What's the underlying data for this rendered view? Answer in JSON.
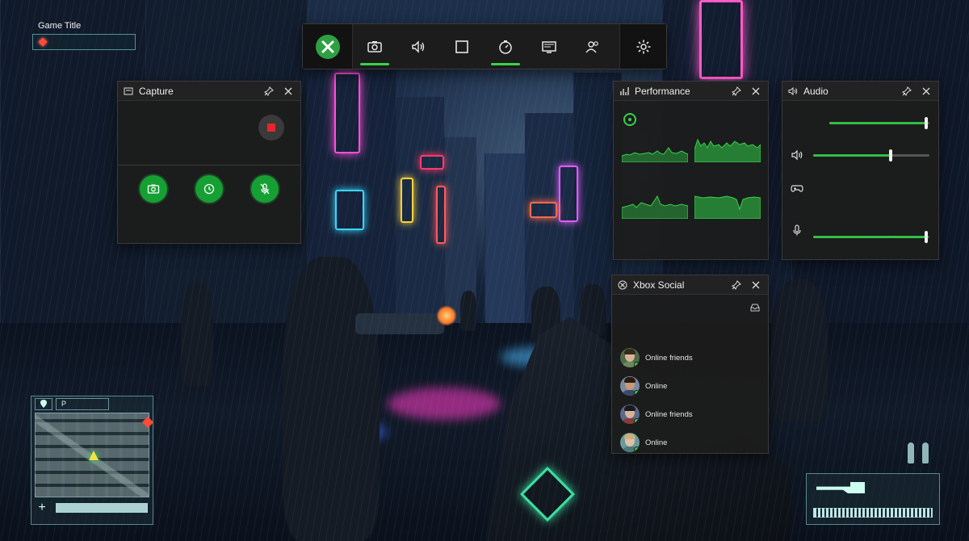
{
  "game_hud": {
    "title": "Game Title",
    "minimap_tabs": [
      "",
      "P"
    ]
  },
  "gamebar": {
    "buttons": [
      {
        "name": "capture",
        "icon": "camera-icon",
        "active": true
      },
      {
        "name": "audio",
        "icon": "speaker-icon",
        "active": false
      },
      {
        "name": "resources",
        "icon": "square-icon",
        "active": false
      },
      {
        "name": "performance",
        "icon": "gauge-icon",
        "active": true
      },
      {
        "name": "gallery",
        "icon": "monitor-icon",
        "active": false
      },
      {
        "name": "social",
        "icon": "people-icon",
        "active": false
      }
    ],
    "accent": "#3bd14a"
  },
  "capture": {
    "title": "Capture",
    "buttons": [
      "camera-icon",
      "record-last-icon",
      "mic-icon"
    ],
    "record_color": "#e8262a"
  },
  "performance": {
    "title": "Performance"
  },
  "audio": {
    "title": "Audio",
    "sliders": [
      {
        "icon": "",
        "level": 0.97
      },
      {
        "icon": "speaker-icon",
        "level": 0.67
      },
      {
        "icon": "gamepad-icon",
        "level": null
      },
      {
        "icon": "mic-icon",
        "level": 0.97
      }
    ]
  },
  "social": {
    "title": "Xbox Social",
    "friends": [
      {
        "status": "Online friends"
      },
      {
        "status": "Online"
      },
      {
        "status": "Online friends"
      },
      {
        "status": "Online"
      }
    ]
  }
}
